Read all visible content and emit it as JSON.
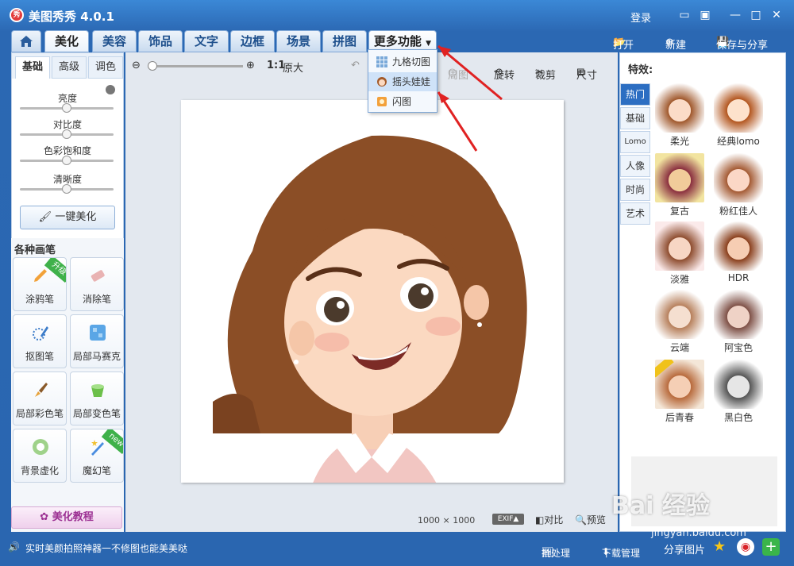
{
  "window": {
    "app_name": "美图秀秀 4.0.1",
    "logo_text": "秀",
    "login": "登录"
  },
  "main_tabs": [
    "美化",
    "美容",
    "饰品",
    "文字",
    "边框",
    "场景",
    "拼图",
    "更多功能"
  ],
  "top_actions": {
    "open": "打开",
    "new": "新建",
    "save_share": "保存与分享"
  },
  "left": {
    "subtabs": [
      "基础",
      "高级",
      "调色"
    ],
    "sliders": [
      {
        "label": "亮度",
        "value": 0.5
      },
      {
        "label": "对比度",
        "value": 0.5
      },
      {
        "label": "色彩饱和度",
        "value": 0.5
      },
      {
        "label": "清晰度",
        "value": 0.5
      }
    ],
    "one_key": "一键美化",
    "brush_title": "各种画笔",
    "tools": [
      {
        "label": "涂鸦笔",
        "badge": "升级"
      },
      {
        "label": "消除笔",
        "badge": ""
      },
      {
        "label": "抠图笔",
        "badge": ""
      },
      {
        "label": "局部马赛克",
        "badge": ""
      },
      {
        "label": "局部彩色笔",
        "badge": ""
      },
      {
        "label": "局部变色笔",
        "badge": ""
      },
      {
        "label": "背景虚化",
        "badge": ""
      },
      {
        "label": "魔幻笔",
        "badge": "new"
      }
    ],
    "tutorial": "美化教程"
  },
  "toolbar": {
    "ratio": "1:1",
    "original": "原大",
    "rotate": "旋转",
    "crop": "裁剪",
    "size": "尺寸",
    "dim_label": "周图"
  },
  "dropdown": {
    "items": [
      "九格切图",
      "摇头娃娃",
      "闪图"
    ],
    "hovered_index": 1
  },
  "canvas": {
    "width_px": "1000",
    "x": "×",
    "height_px": "1000",
    "exif": "EXIF",
    "compare": "对比",
    "preview": "预览"
  },
  "right": {
    "title": "特效:",
    "categories": [
      "热门",
      "基础",
      "Lomo",
      "人像",
      "时尚",
      "艺术"
    ],
    "effects": [
      "柔光",
      "经典lomo",
      "复古",
      "粉红佳人",
      "淡雅",
      "HDR",
      "云端",
      "阿宝色",
      "后青春",
      "黑白色"
    ]
  },
  "status": {
    "tip": "实时美颜拍照神器一不修图也能美美哒",
    "batch": "批处理",
    "download": "下载管理",
    "share": "分享图片"
  },
  "watermark": {
    "brand": "Bai 经验",
    "url": "jingyan.baidu.com"
  }
}
